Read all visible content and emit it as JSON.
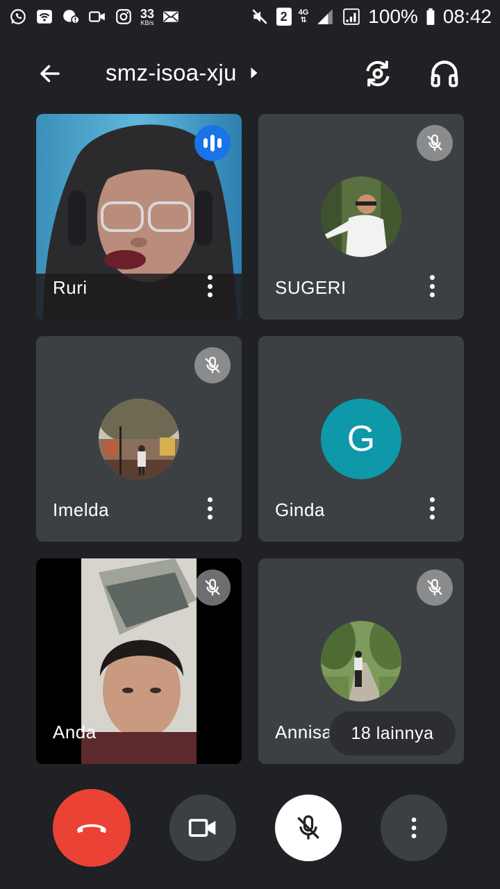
{
  "status_bar": {
    "speed_value": "33",
    "speed_unit": "KB/s",
    "sim_slot": "2",
    "network_type": "4G",
    "battery": "100%",
    "time": "08:42",
    "left_icons": [
      "whatsapp-icon",
      "wifi-icon",
      "messenger-icon",
      "video-call-icon",
      "instagram-icon"
    ],
    "right_icons": [
      "mute-icon",
      "signal-icon",
      "battery-icon"
    ]
  },
  "header": {
    "meeting_code": "smz-isoa-xju",
    "icons": [
      "back-arrow-icon",
      "chevron-right-icon",
      "switch-camera-icon",
      "headphones-icon"
    ]
  },
  "participants": [
    {
      "name": "Ruri",
      "state": "speaking",
      "media": "video"
    },
    {
      "name": "SUGERI",
      "state": "muted",
      "media": "photo-avatar"
    },
    {
      "name": "Imelda",
      "state": "muted",
      "media": "photo-avatar"
    },
    {
      "name": "Ginda",
      "state": "unmuted",
      "media": "letter-avatar",
      "initial": "G",
      "avatar_color": "#0e98a8"
    },
    {
      "name": "Anda",
      "state": "muted",
      "media": "video"
    },
    {
      "name": "Annisa",
      "state": "muted",
      "media": "photo-avatar"
    }
  ],
  "more_participants_label": "18 lainnya",
  "controls": {
    "end_call_color": "#ea4335",
    "icons": [
      "end-call-icon",
      "camera-icon",
      "mic-off-icon",
      "more-vert-icon"
    ]
  }
}
